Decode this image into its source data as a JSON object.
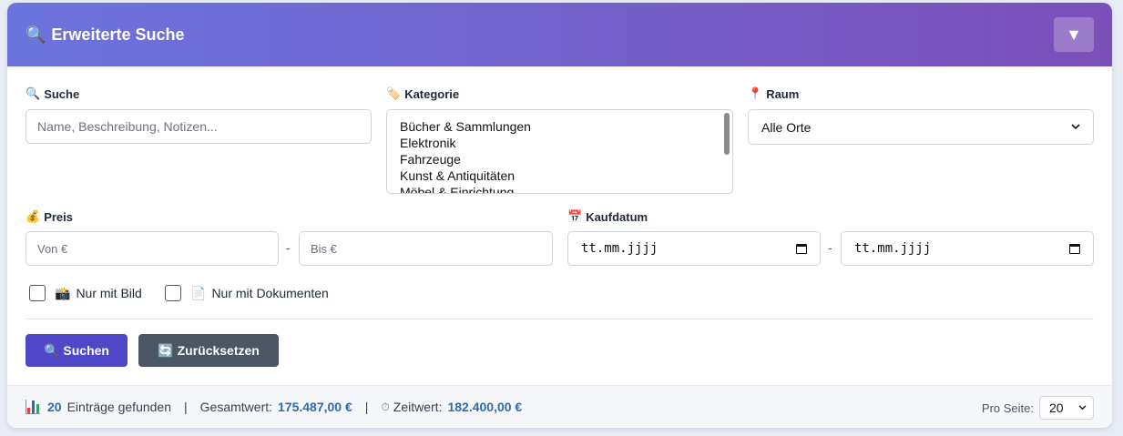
{
  "header": {
    "icon": "🔍",
    "title": "Erweiterte Suche",
    "toggle_glyph": "▼"
  },
  "search": {
    "icon": "🔍",
    "label": "Suche",
    "placeholder": "Name, Beschreibung, Notizen..."
  },
  "category": {
    "icon": "🏷️",
    "label": "Kategorie",
    "options": [
      "Bücher & Sammlungen",
      "Elektronik",
      "Fahrzeuge",
      "Kunst & Antiquitäten",
      "Möbel & Einrichtung"
    ]
  },
  "room": {
    "icon": "📍",
    "label": "Raum",
    "selected": "Alle Orte"
  },
  "price": {
    "icon": "💰",
    "label": "Preis",
    "from_placeholder": "Von €",
    "to_placeholder": "Bis €",
    "separator": "-"
  },
  "purchase_date": {
    "icon": "📅",
    "label": "Kaufdatum",
    "from_value": "tt.mm.jjjj",
    "to_value": "tt.mm.jjjj",
    "separator": "-"
  },
  "filters": {
    "only_image": {
      "icon": "📸",
      "label": "Nur mit Bild",
      "checked": false
    },
    "only_documents": {
      "icon": "📄",
      "label": "Nur mit Dokumenten",
      "checked": false
    }
  },
  "buttons": {
    "search": {
      "icon": "🔍",
      "label": "Suchen"
    },
    "reset": {
      "icon": "🔄",
      "label": "Zurücksetzen"
    }
  },
  "footer": {
    "count": "20",
    "count_label": "Einträge gefunden",
    "separator": "|",
    "total_label": "Gesamtwert:",
    "total_value": "175.487,00 €",
    "current_icon": "⏱",
    "current_label": "Zeitwert:",
    "current_value": "182.400,00 €",
    "per_page_label": "Pro Seite:",
    "per_page_value": "20"
  },
  "colors": {
    "header_start": "#6b74de",
    "header_end": "#7b4fb8",
    "primary": "#4f46c8",
    "secondary": "#4b5563",
    "value_blue": "#2b6cb0"
  }
}
